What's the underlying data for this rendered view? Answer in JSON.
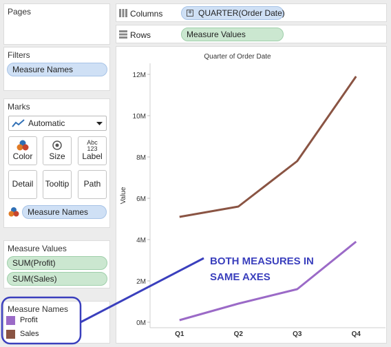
{
  "cards": {
    "pages": {
      "title": "Pages"
    },
    "filters": {
      "title": "Filters",
      "pill": "Measure Names"
    },
    "marks": {
      "title": "Marks",
      "type": "Automatic",
      "buttons": {
        "color": "Color",
        "size": "Size",
        "label": "Label",
        "label_icon_top": "Abc",
        "label_icon_bottom": "123",
        "detail": "Detail",
        "tooltip": "Tooltip",
        "path": "Path"
      },
      "color_pill": "Measure Names"
    },
    "measure_values": {
      "title": "Measure Values",
      "items": [
        "SUM(Profit)",
        "SUM(Sales)"
      ]
    },
    "measure_names": {
      "title": "Measure Names",
      "items": [
        {
          "label": "Profit",
          "color": "#9b6ac7"
        },
        {
          "label": "Sales",
          "color": "#8a5443"
        }
      ]
    }
  },
  "shelves": {
    "columns": {
      "label": "Columns",
      "pill": "QUARTER(Order Date)"
    },
    "rows": {
      "label": "Rows",
      "pill": "Measure Values"
    }
  },
  "annotation": {
    "line1": "BOTH MEASURES IN",
    "line2": "SAME AXES",
    "color": "#3a3fbd"
  },
  "chart_data": {
    "type": "line",
    "title": "Quarter of Order Date",
    "ylabel": "Value",
    "xlabel": "",
    "categories": [
      "Q1",
      "Q2",
      "Q3",
      "Q4"
    ],
    "y_ticks": [
      "0M",
      "2M",
      "4M",
      "6M",
      "8M",
      "10M",
      "12M"
    ],
    "ylim": [
      0,
      12000000
    ],
    "grid": false,
    "series": [
      {
        "name": "Profit",
        "color": "#9b6ac7",
        "values": [
          100000,
          900000,
          1600000,
          3900000
        ]
      },
      {
        "name": "Sales",
        "color": "#8a5443",
        "values": [
          5100000,
          5600000,
          7800000,
          11900000
        ]
      }
    ]
  }
}
